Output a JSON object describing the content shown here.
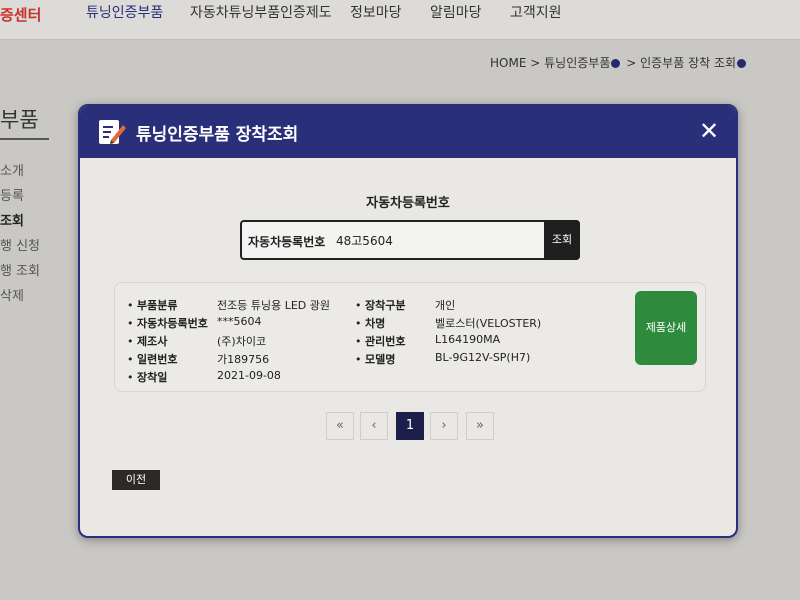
{
  "top_nav": {
    "logo_text": "증센터",
    "items": [
      "튜닝인증부품",
      "자동차튜닝부품인증제도",
      "정보마당",
      "알림마당",
      "고객지원"
    ]
  },
  "breadcrumb": {
    "home": "HOME",
    "sep": ">",
    "level1": "튜닝인증부품",
    "level2": "인증부품 장착 조회"
  },
  "sidebar": {
    "title": "부품",
    "items": [
      "소개",
      "등록",
      "조회",
      "행 신청",
      "행 조회",
      "삭제"
    ],
    "active_index": 2
  },
  "modal": {
    "title": "튜닝인증부품 장착조회",
    "close_symbol": "✕",
    "search_heading": "자동차등록번호",
    "search_label": "자동차등록번호",
    "search_value": "48고5604",
    "search_button": "조회",
    "result": {
      "left_fields": [
        {
          "label": "부품분류",
          "value": "전조등 튜닝용 LED 광원"
        },
        {
          "label": "자동차등록번호",
          "value": "***5604"
        },
        {
          "label": "제조사",
          "value": "(주)차이코"
        },
        {
          "label": "일련번호",
          "value": "가189756"
        },
        {
          "label": "장착일",
          "value": "2021-09-08"
        }
      ],
      "right_fields": [
        {
          "label": "장착구분",
          "value": "개인"
        },
        {
          "label": "차명",
          "value": "벨로스터(VELOSTER)"
        },
        {
          "label": "관리번호",
          "value": "L164190MA"
        },
        {
          "label": "모델명",
          "value": "BL-9G12V-SP(H7)"
        }
      ],
      "detail_button": "제품상세"
    },
    "pagination": {
      "first": "«",
      "prev": "‹",
      "current": "1",
      "next": "›",
      "last": "»"
    },
    "back_button": "이전"
  },
  "colors": {
    "header_navy": "#2a2f7a",
    "detail_green": "#2e8b3d",
    "active_page": "#1b1f4a",
    "logo_red": "#c8322a"
  }
}
